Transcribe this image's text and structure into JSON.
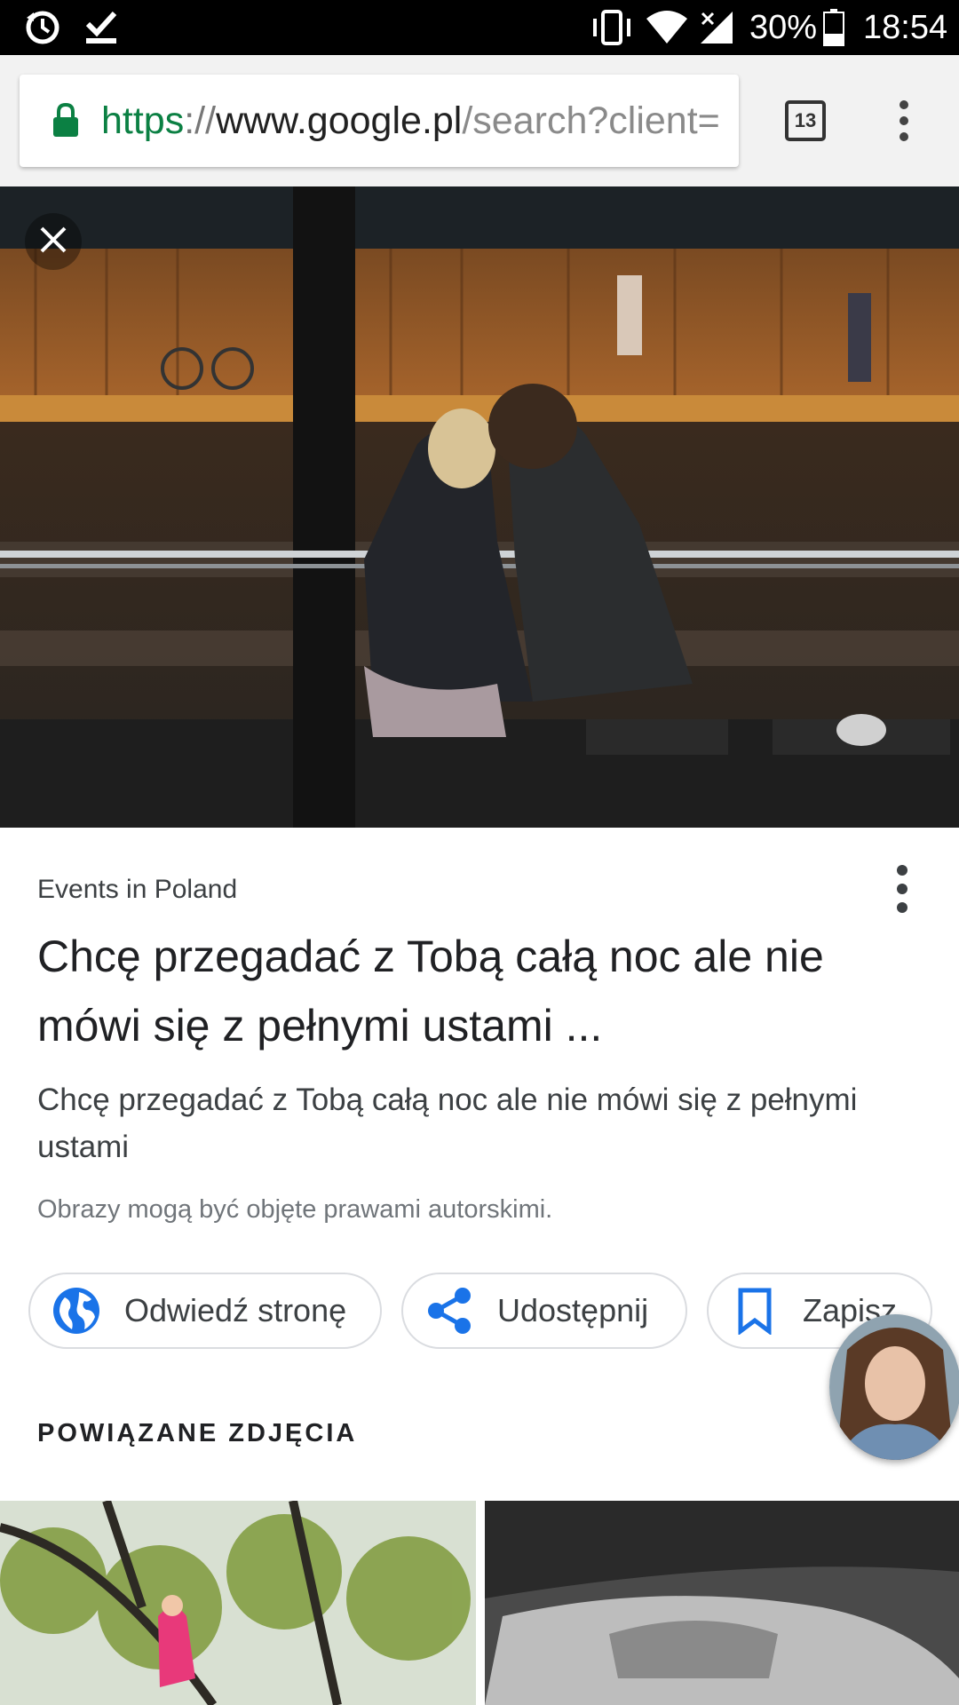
{
  "status_bar": {
    "battery": "30%",
    "time": "18:54",
    "icons": [
      "sync-timer-icon",
      "download-done-icon",
      "vibrate-icon",
      "wifi-icon",
      "signal-icon",
      "battery-icon"
    ]
  },
  "browser": {
    "url_scheme": "https",
    "url_sep": "://",
    "url_host": "www.google.pl",
    "url_path": "/search?client=",
    "tab_count": "13"
  },
  "result": {
    "source": "Events in Poland",
    "title": "Chcę przegadać z Tobą całą noc ale nie mówi się z pełnymi ustami ...",
    "description": "Chcę przegadać z Tobą całą noc ale nie mówi się z pełnymi ustami",
    "copyright": "Obrazy mogą być objęte prawami autorskimi."
  },
  "actions": {
    "visit": "Odwiedź stronę",
    "share": "Udostępnij",
    "save": "Zapisz"
  },
  "related": {
    "heading": "POWIĄZANE ZDJĘCIA"
  },
  "colors": {
    "secure_green": "#0b8043",
    "action_blue": "#1a73e8"
  }
}
